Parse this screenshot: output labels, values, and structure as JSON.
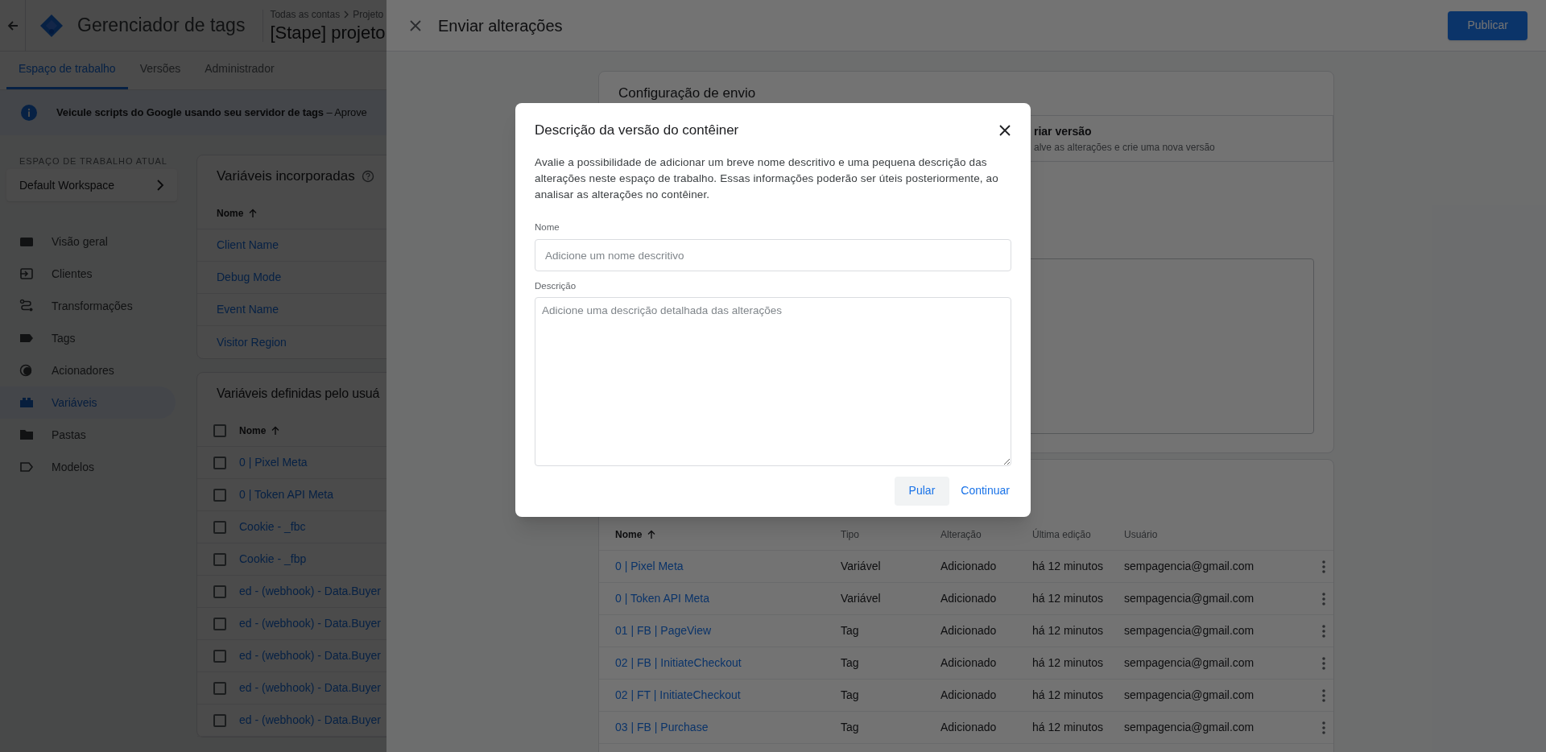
{
  "header": {
    "title": "Gerenciador de tags",
    "breadcrumb": [
      "Todas as contas",
      "Projeto"
    ],
    "container": "[Stape] projeto"
  },
  "tabs": [
    {
      "label": "Espaço de trabalho",
      "selected": true
    },
    {
      "label": "Versões",
      "selected": false
    },
    {
      "label": "Administrador",
      "selected": false
    }
  ],
  "banner": {
    "text": "**Veicule scripts do Google usando seu servidor de tags** – Aprove"
  },
  "sidebar": {
    "workspace_label": "ESPAÇO DE TRABALHO ATUAL",
    "workspace": "Default Workspace",
    "items": [
      {
        "label": "Visão geral",
        "kind": "overview",
        "selected": false
      },
      {
        "label": "Clientes",
        "kind": "clients",
        "selected": false
      },
      {
        "label": "Transformações",
        "kind": "transform",
        "selected": false
      },
      {
        "label": "Tags",
        "kind": "tag",
        "selected": false
      },
      {
        "label": "Acionadores",
        "kind": "trigger",
        "selected": false
      },
      {
        "label": "Variáveis",
        "kind": "variable",
        "selected": true
      },
      {
        "label": "Pastas",
        "kind": "folder",
        "selected": false
      },
      {
        "label": "Modelos",
        "kind": "template",
        "selected": false
      }
    ]
  },
  "builtin_variables": {
    "title": "Variáveis incorporadas",
    "column": "Nome",
    "rows": [
      "Client Name",
      "Debug Mode",
      "Event Name",
      "Visitor Region"
    ]
  },
  "user_variables": {
    "title": "Variáveis definidas pelo usuá",
    "column": "Nome",
    "all_checked": false,
    "rows": [
      {
        "name": "0 | Pixel Meta",
        "checked": false
      },
      {
        "name": "0 | Token API Meta",
        "checked": false
      },
      {
        "name": "Cookie - _fbc",
        "checked": false
      },
      {
        "name": "Cookie - _fbp",
        "checked": false
      },
      {
        "name": "ed - (webhook) - Data.Buyer",
        "checked": false
      },
      {
        "name": "ed - (webhook) - Data.Buyer",
        "checked": false
      },
      {
        "name": "ed - (webhook) - Data.Buyer",
        "checked": false
      },
      {
        "name": "ed - (webhook) - Data.Buyer",
        "checked": false
      },
      {
        "name": "ed - (webhook) - Data.Buyer",
        "checked": false
      }
    ]
  },
  "panel": {
    "title": "Enviar alterações",
    "publish_button": "Publicar",
    "settings": {
      "title": "Configuração de envio",
      "option": {
        "title": "riar versão",
        "subtitle": "alve as alterações e crie uma nova versão"
      }
    },
    "changes": {
      "columns": [
        "Nome",
        "Tipo",
        "Alteração",
        "Última edição",
        "Usuário"
      ],
      "rows": [
        {
          "name": "0 | Pixel Meta",
          "type": "Variável",
          "change": "Adicionado",
          "edited": "há 12 minutos",
          "user": "sempagencia@gmail.com"
        },
        {
          "name": "0 | Token API Meta",
          "type": "Variável",
          "change": "Adicionado",
          "edited": "há 12 minutos",
          "user": "sempagencia@gmail.com"
        },
        {
          "name": "01 | FB | PageView",
          "type": "Tag",
          "change": "Adicionado",
          "edited": "há 12 minutos",
          "user": "sempagencia@gmail.com"
        },
        {
          "name": "02 | FB | InitiateCheckout",
          "type": "Tag",
          "change": "Adicionado",
          "edited": "há 12 minutos",
          "user": "sempagencia@gmail.com"
        },
        {
          "name": "02 | FT | InitiateCheckout",
          "type": "Tag",
          "change": "Adicionado",
          "edited": "há 12 minutos",
          "user": "sempagencia@gmail.com"
        },
        {
          "name": "03 | FB | Purchase",
          "type": "Tag",
          "change": "Adicionado",
          "edited": "há 12 minutos",
          "user": "sempagencia@gmail.com"
        }
      ]
    }
  },
  "dialog": {
    "title": "Descrição da versão do contêiner",
    "text": "Avalie a possibilidade de adicionar um breve nome descritivo e uma pequena descrição das alterações neste espaço de trabalho. Essas informações poderão ser úteis posteriormente, ao analisar as alterações no contêiner.",
    "name_label": "Nome",
    "name_placeholder": "Adicione um nome descritivo",
    "description_label": "Descrição",
    "description_placeholder": "Adicione uma descrição detalhada das alterações",
    "buttons": [
      {
        "label": "Pular",
        "focused": true
      },
      {
        "label": "Continuar",
        "focused": false
      }
    ]
  }
}
